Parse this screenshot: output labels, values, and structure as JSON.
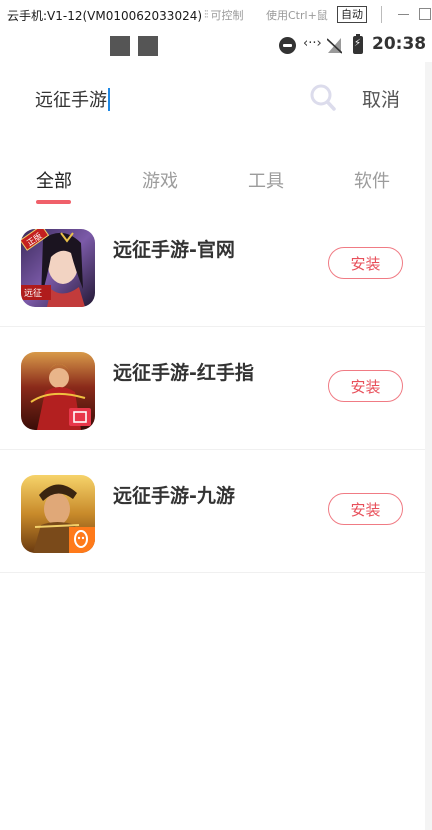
{
  "emulator": {
    "title": "云手机:V1-12(VM010062033024)",
    "control_label": "可控制",
    "hint_label": "使用Ctrl+鼠",
    "auto_label": "自动"
  },
  "status_bar": {
    "time": "20:38",
    "data_indicator": "‹··›"
  },
  "search": {
    "query": "远征手游",
    "cancel_label": "取消"
  },
  "tabs": [
    {
      "label": "全部",
      "active": true
    },
    {
      "label": "游戏",
      "active": false
    },
    {
      "label": "工具",
      "active": false
    },
    {
      "label": "软件",
      "active": false
    }
  ],
  "results": [
    {
      "name": "远征手游-官网",
      "install_label": "安装",
      "badge": "正版",
      "corner_text": "远征"
    },
    {
      "name": "远征手游-红手指",
      "install_label": "安装"
    },
    {
      "name": "远征手游-九游",
      "install_label": "安装"
    }
  ],
  "colors": {
    "accent": "#f0606a",
    "install_text": "#e8505b",
    "caret": "#1e88e5"
  }
}
